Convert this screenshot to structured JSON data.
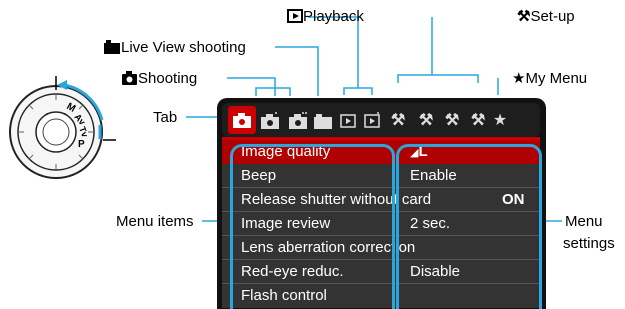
{
  "labels": {
    "playback": "Playback",
    "setup": "Set-up",
    "live_view": "Live View shooting",
    "shooting": "Shooting",
    "my_menu": "My Menu",
    "tab": "Tab",
    "menu_items": "Menu items",
    "menu_settings_line1": "Menu",
    "menu_settings_line2": "settings"
  },
  "dial_letters": [
    "M",
    "Av",
    "Tv",
    "P"
  ],
  "menu": {
    "rows": [
      {
        "name": "Image quality",
        "value": "L",
        "extra": ""
      },
      {
        "name": "Beep",
        "value": "Enable",
        "extra": ""
      },
      {
        "name": "Release shutter without card",
        "value": "",
        "extra": "ON"
      },
      {
        "name": "Image review",
        "value": "2 sec.",
        "extra": ""
      },
      {
        "name": "Lens aberration correction",
        "value": "",
        "extra": ""
      },
      {
        "name": "Red-eye reduc.",
        "value": "Disable",
        "extra": ""
      },
      {
        "name": "Flash control",
        "value": "",
        "extra": ""
      }
    ],
    "selected_index": 0
  },
  "tabs": [
    "shooting-1",
    "shooting-2",
    "shooting-3",
    "live-view",
    "playback-1",
    "playback-2",
    "setup-1",
    "setup-2",
    "setup-3",
    "setup-4",
    "my-menu"
  ],
  "colors": {
    "accent_blue": "#2aa6dd",
    "selected_red": "#cc0000",
    "menu_bg": "#333333"
  }
}
